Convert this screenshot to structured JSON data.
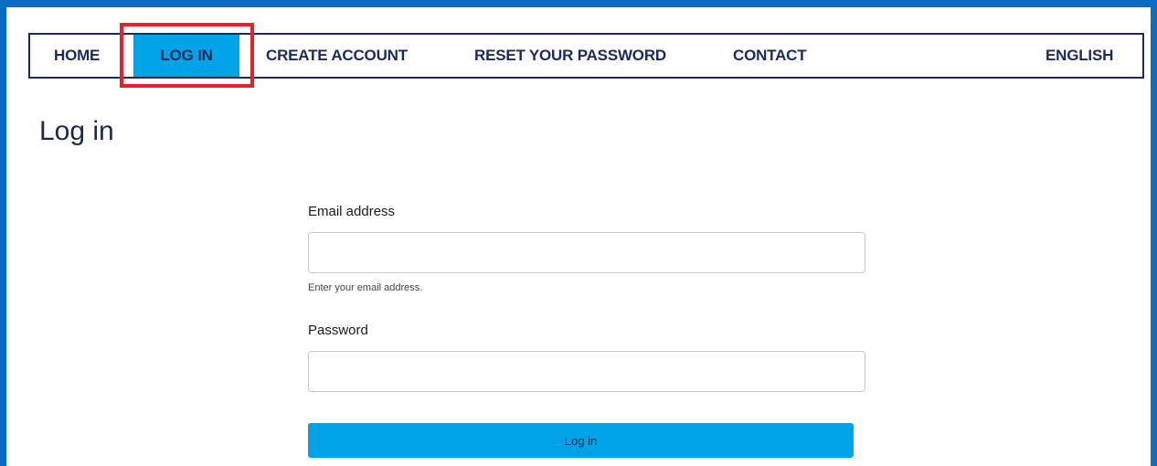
{
  "colors": {
    "frame": "#0a6cc2",
    "nav_border": "#1b2a5a",
    "accent": "#00a3e8",
    "highlight": "#e8202a"
  },
  "nav": {
    "items": [
      {
        "label": "HOME",
        "active": false
      },
      {
        "label": "LOG IN",
        "active": true
      },
      {
        "label": "CREATE ACCOUNT",
        "active": false
      },
      {
        "label": "RESET YOUR PASSWORD",
        "active": false
      },
      {
        "label": "CONTACT",
        "active": false
      }
    ],
    "language": "ENGLISH"
  },
  "page": {
    "title": "Log in"
  },
  "form": {
    "email_label": "Email address",
    "email_value": "",
    "email_hint": "Enter your email address.",
    "password_label": "Password",
    "password_value": "",
    "submit_label": "Log in"
  }
}
